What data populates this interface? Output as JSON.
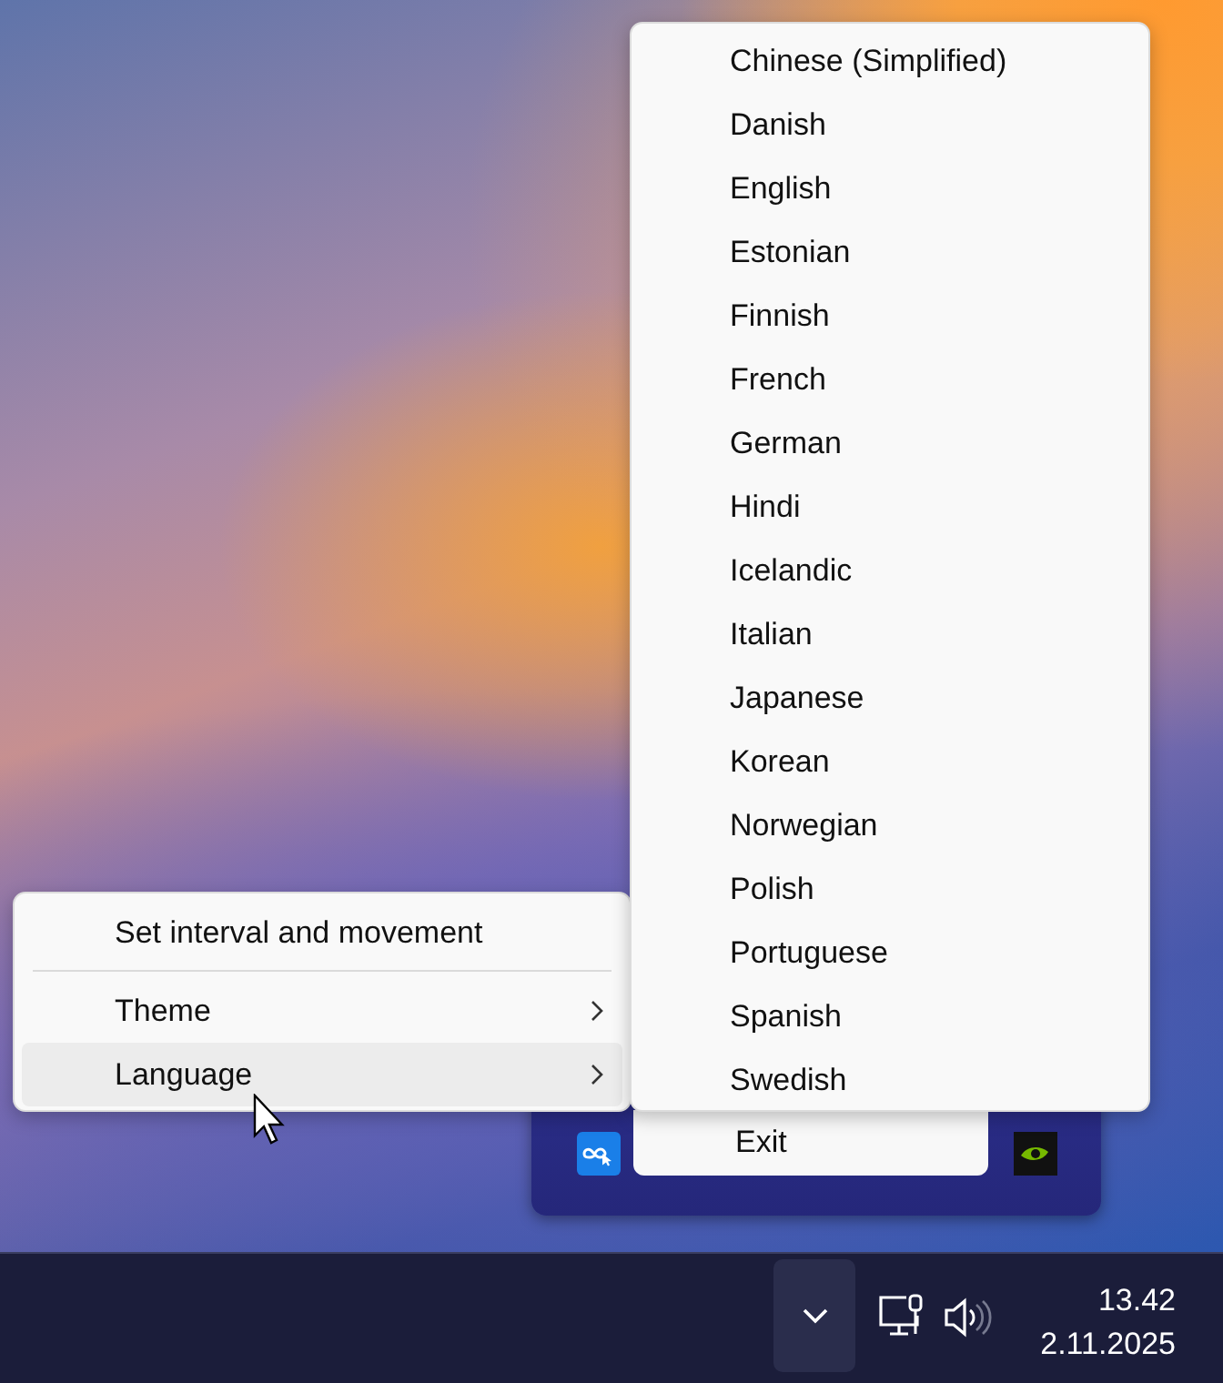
{
  "context_menu": {
    "items": [
      {
        "kind": "command",
        "label": "Set interval and movement"
      },
      {
        "kind": "separator"
      },
      {
        "kind": "submenu",
        "label": "Theme",
        "expanded": false
      },
      {
        "kind": "submenu",
        "label": "Language",
        "expanded": true
      }
    ]
  },
  "language_submenu": {
    "items": [
      "Chinese (Simplified)",
      "Danish",
      "English",
      "Estonian",
      "Finnish",
      "French",
      "German",
      "Hindi",
      "Icelandic",
      "Italian",
      "Japanese",
      "Korean",
      "Norwegian",
      "Polish",
      "Portuguese",
      "Spanish",
      "Swedish"
    ]
  },
  "tray_flyout": {
    "menu_items": [
      "Exit"
    ]
  },
  "taskbar": {
    "time": "13.42",
    "date": "2.11.2025"
  }
}
